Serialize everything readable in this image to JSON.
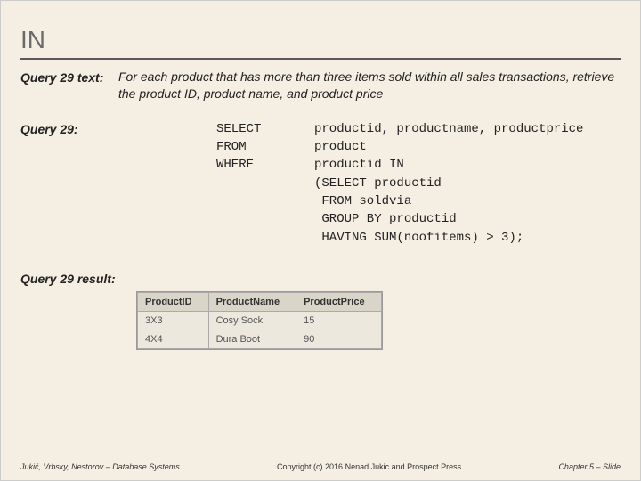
{
  "title": "IN",
  "query_text": {
    "label": "Query 29 text:",
    "body": "For each product that has more than three items sold within all sales transactions, retrieve the product ID, product name, and product price"
  },
  "query": {
    "label": "Query 29:",
    "keywords": "SELECT\nFROM\nWHERE",
    "body": "productid, productname, productprice\nproduct\nproductid IN\n(SELECT productid\n FROM soldvia\n GROUP BY productid\n HAVING SUM(noofitems) > 3);"
  },
  "result": {
    "label": "Query 29 result:",
    "headers": [
      "ProductID",
      "ProductName",
      "ProductPrice"
    ],
    "rows": [
      [
        "3X3",
        "Cosy Sock",
        "15"
      ],
      [
        "4X4",
        "Dura Boot",
        "90"
      ]
    ]
  },
  "footer": {
    "left": "Jukić, Vrbsky, Nestorov – Database Systems",
    "center": "Copyright (c) 2016 Nenad Jukic and Prospect Press",
    "right": "Chapter 5 – Slide"
  }
}
